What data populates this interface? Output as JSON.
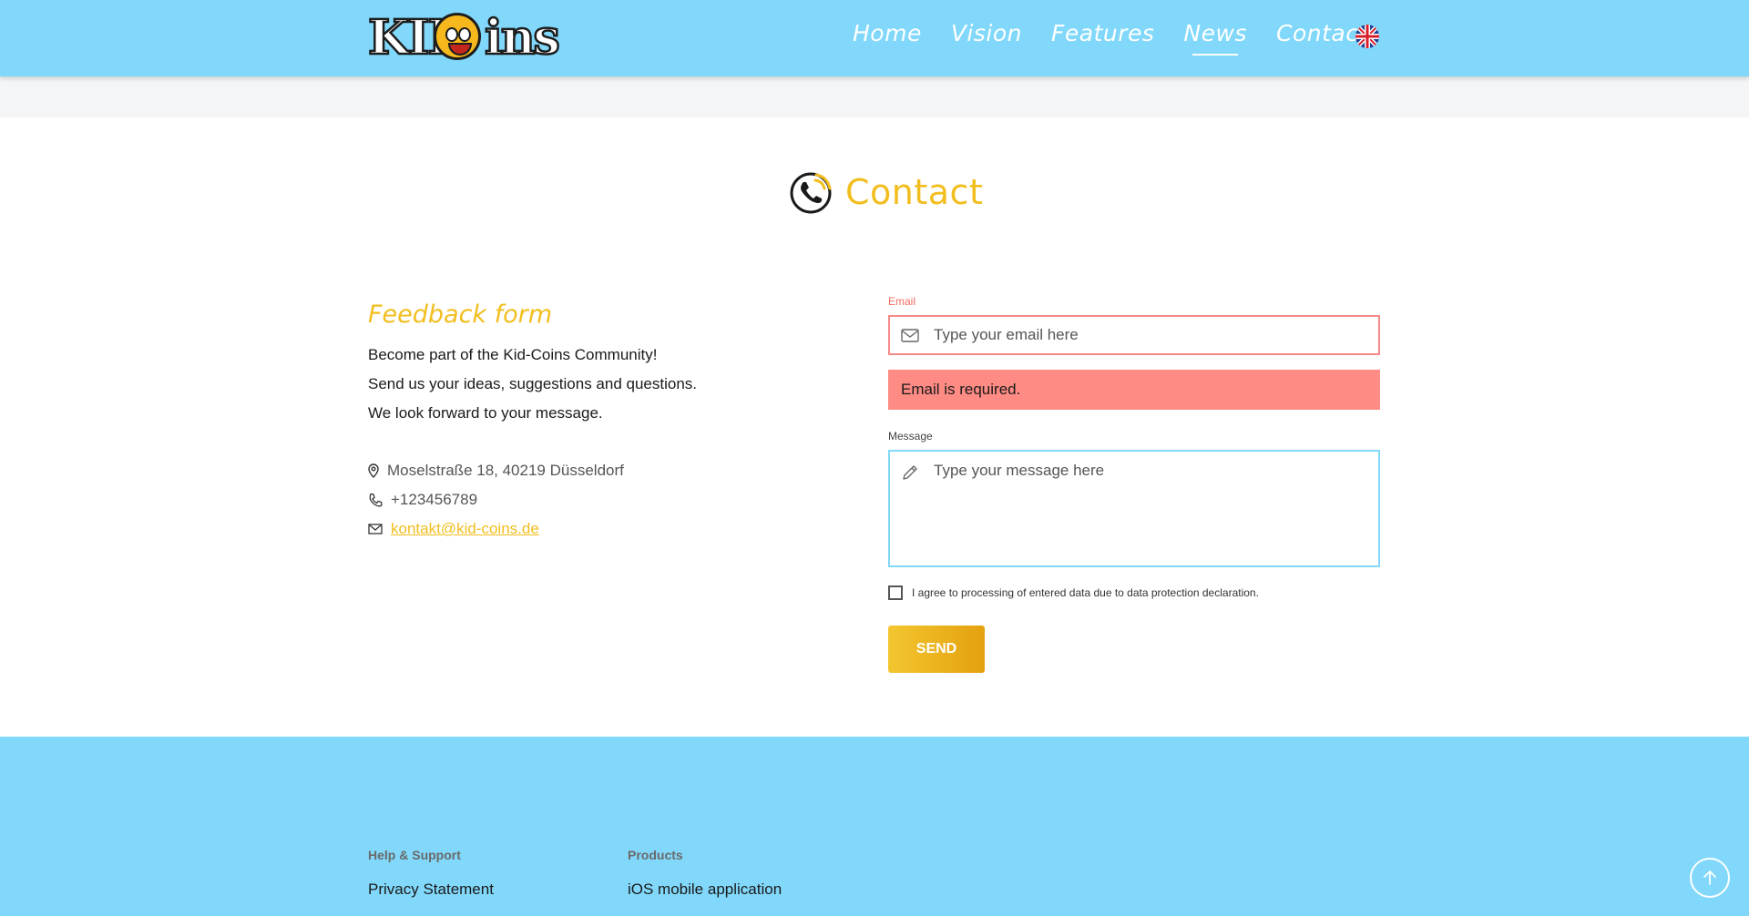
{
  "header": {
    "logo_text": "KID COINS",
    "nav": [
      {
        "label": "Home",
        "active": false
      },
      {
        "label": "Vision",
        "active": false
      },
      {
        "label": "Features",
        "active": false
      },
      {
        "label": "News",
        "active": true
      },
      {
        "label": "Contact",
        "active": false
      }
    ],
    "language_icon": "uk-flag-icon"
  },
  "contact": {
    "title": "Contact",
    "icon": "phone-icon"
  },
  "feedback": {
    "title": "Feedback form",
    "lines": [
      "Become part of the Kid-Coins Community!",
      "Send us your ideas, suggestions and questions.",
      "We look forward to your message."
    ],
    "address": "Moselstraße 18, 40219 Düsseldorf",
    "phone": "+123456789",
    "email": "kontakt@kid-coins.de"
  },
  "form": {
    "email_label": "Email",
    "email_placeholder": "Type your email here",
    "email_value": "",
    "email_error": "Email is required.",
    "message_label": "Message",
    "message_placeholder": "Type your message here",
    "message_value": "",
    "consent_text": "I agree to processing of entered data due to data protection declaration.",
    "consent_checked": false,
    "send_label": "SEND"
  },
  "footer": {
    "columns": [
      {
        "heading": "Help & Support",
        "links": [
          "Privacy Statement"
        ]
      },
      {
        "heading": "Products",
        "links": [
          "iOS mobile application"
        ]
      }
    ]
  },
  "colors": {
    "header_bg": "#81d8fb",
    "accent_yellow": "#f2be1f",
    "error_red": "#fe8b84"
  }
}
